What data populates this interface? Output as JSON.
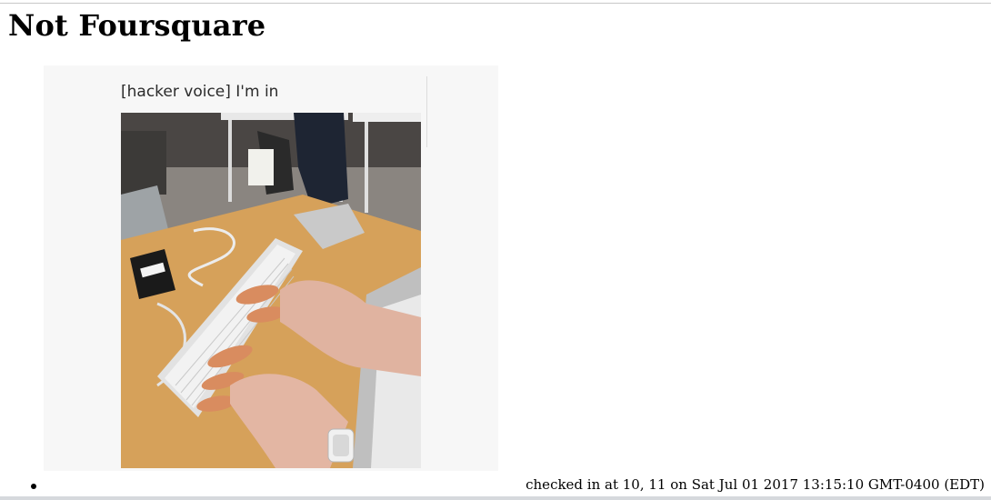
{
  "page": {
    "title": "Not Foursquare"
  },
  "post": {
    "meme_caption": "[hacker voice] I'm in",
    "image_icon": "photo-image",
    "checkin_text": "checked in at 10, 11 on Sat Jul 01 2017 13:15:10 GMT-0400 (EDT)"
  },
  "colors": {
    "background": "#ffffff",
    "text": "#000000",
    "desk": "#d9a45a",
    "keyboard": "#e6e6e6",
    "floor": "#7a7470"
  }
}
